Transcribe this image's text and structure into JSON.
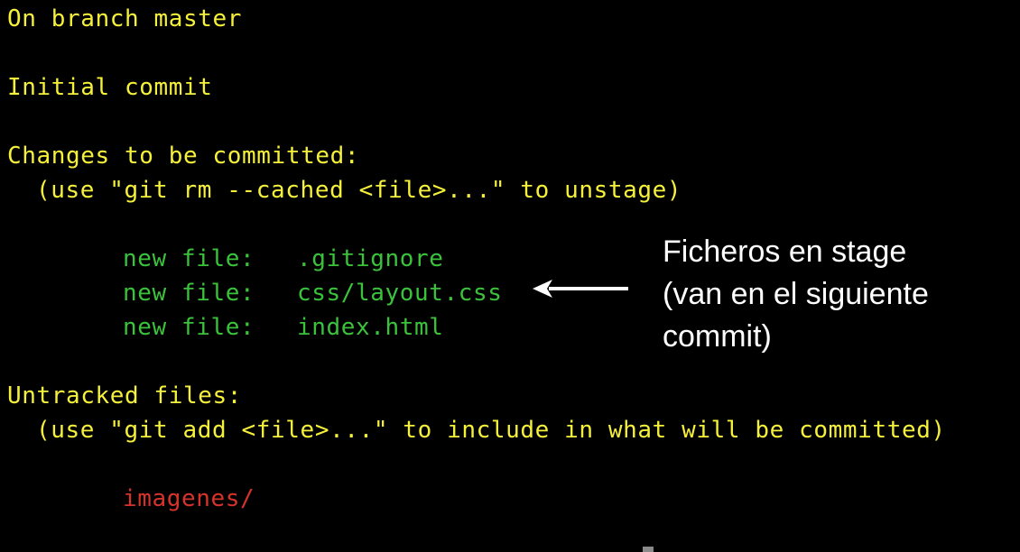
{
  "terminal": {
    "lines": {
      "on_branch": "On branch master",
      "initial_commit": "Initial commit",
      "changes_header": "Changes to be committed:",
      "unstage_hint": "(use \"git rm --cached <file>...\" to unstage)",
      "untracked_header": "Untracked files:",
      "add_hint": "(use \"git add <file>...\" to include in what will be committed)"
    },
    "staged_files": [
      {
        "status": "new file:",
        "path": ".gitignore"
      },
      {
        "status": "new file:",
        "path": "css/layout.css"
      },
      {
        "status": "new file:",
        "path": "index.html"
      }
    ],
    "untracked_files": [
      {
        "path": "imagenes/"
      }
    ]
  },
  "annotation": {
    "lines": [
      "Ficheros en stage",
      "(van en el siguiente",
      "commit)"
    ]
  },
  "colors": {
    "background": "#000000",
    "header_text": "#f5f03a",
    "staged_text": "#3bc23b",
    "untracked_text": "#d6342a",
    "annotation_text": "#ffffff"
  },
  "icons": {
    "arrow": "left-arrow-icon"
  }
}
